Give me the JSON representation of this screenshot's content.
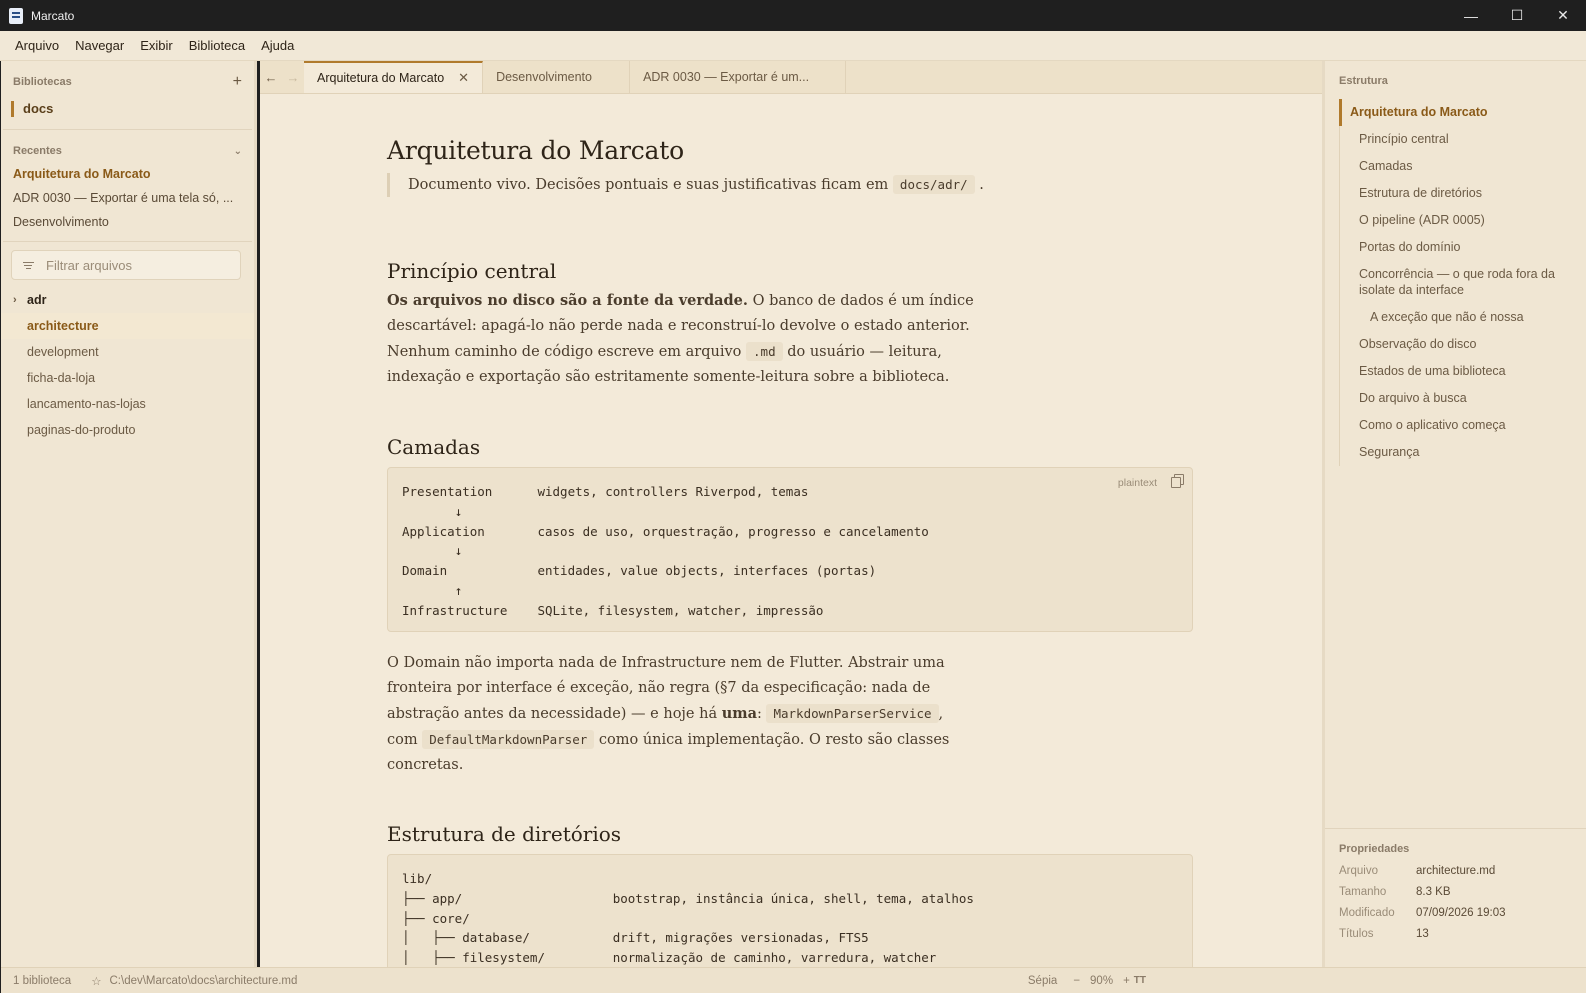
{
  "window": {
    "title": "Marcato",
    "minimize": "—",
    "maximize": "☐",
    "close": "✕"
  },
  "menu": [
    "Arquivo",
    "Navegar",
    "Exibir",
    "Biblioteca",
    "Ajuda"
  ],
  "sidebar": {
    "libraries_title": "Bibliotecas",
    "library": "docs",
    "recents_title": "Recentes",
    "recents": [
      "Arquitetura do Marcato",
      "ADR 0030 — Exportar é uma tela só, ...",
      "Desenvolvimento"
    ],
    "filter_placeholder": "Filtrar arquivos",
    "tree": [
      "adr",
      "architecture",
      "development",
      "ficha-da-loja",
      "lancamento-nas-lojas",
      "paginas-do-produto"
    ]
  },
  "tabs": [
    "Arquitetura do Marcato",
    "Desenvolvimento",
    "ADR 0030 — Exportar é um..."
  ],
  "doc": {
    "title": "Arquitetura do Marcato",
    "quote_text": "Documento vivo. Decisões pontuais e suas justificativas ficam em",
    "quote_code": "docs/adr/",
    "quote_end": ".",
    "h_principio": "Princípio central",
    "p1_bold": "Os arquivos no disco são a fonte da verdade.",
    "p1_a": " O banco de dados é um índice descartável: apagá-lo não perde nada e reconstruí-lo devolve o estado anterior. Nenhum caminho de código escreve em arquivo ",
    "p1_code": ".md",
    "p1_b": " do usuário — leitura, indexação e exportação são estritamente somente-leitura sobre a biblioteca.",
    "h_camadas": "Camadas",
    "code_lang": "plaintext",
    "code_camadas": "Presentation      widgets, controllers Riverpod, temas\n       ↓\nApplication       casos de uso, orquestração, progresso e cancelamento\n       ↓\nDomain            entidades, value objects, interfaces (portas)\n       ↑\nInfrastructure    SQLite, filesystem, watcher, impressão",
    "p2_a": "O Domain não importa nada de Infrastructure nem de Flutter. Abstrair uma fronteira por interface é exceção, não regra (§7 da especificação: nada de abstração antes da necessidade) — e hoje há ",
    "p2_bold": "uma",
    "p2_b": ": ",
    "p2_code1": "MarkdownParserService",
    "p2_c": ", com ",
    "p2_code2": "DefaultMarkdownParser",
    "p2_d": " como única implementação. O resto são classes concretas.",
    "h_estrutura": "Estrutura de diretórios",
    "code_estrutura": "lib/\n├── app/                    bootstrap, instância única, shell, tema, atalhos\n├── core/\n│   ├── database/           drift, migrações versionadas, FTS5\n│   ├── filesystem/         normalização de caminho, varredura, watcher"
  },
  "toc": {
    "title": "Estrutura",
    "items": [
      "Arquitetura do Marcato",
      "Princípio central",
      "Camadas",
      "Estrutura de diretórios",
      "O pipeline (ADR 0005)",
      "Portas do domínio",
      "Concorrência — o que roda fora da isolate da interface",
      "A exceção que não é nossa",
      "Observação do disco",
      "Estados de uma biblioteca",
      "Do arquivo à busca",
      "Como o aplicativo começa",
      "Segurança"
    ]
  },
  "props": {
    "title": "Propriedades",
    "rows": [
      {
        "k": "Arquivo",
        "v": "architecture.md"
      },
      {
        "k": "Tamanho",
        "v": "8.3 KB"
      },
      {
        "k": "Modificado",
        "v": "07/09/2026 19:03"
      },
      {
        "k": "Títulos",
        "v": "13"
      }
    ]
  },
  "status": {
    "libs": "1 biblioteca",
    "path": "C:\\dev\\Marcato\\docs\\architecture.md",
    "theme": "Sépia",
    "minus": "−",
    "zoom": "90%",
    "plus": "+"
  },
  "colors": {
    "accent": "#b07a2c",
    "background": "#f3ead9",
    "sidebar": "#f0e6d3"
  }
}
